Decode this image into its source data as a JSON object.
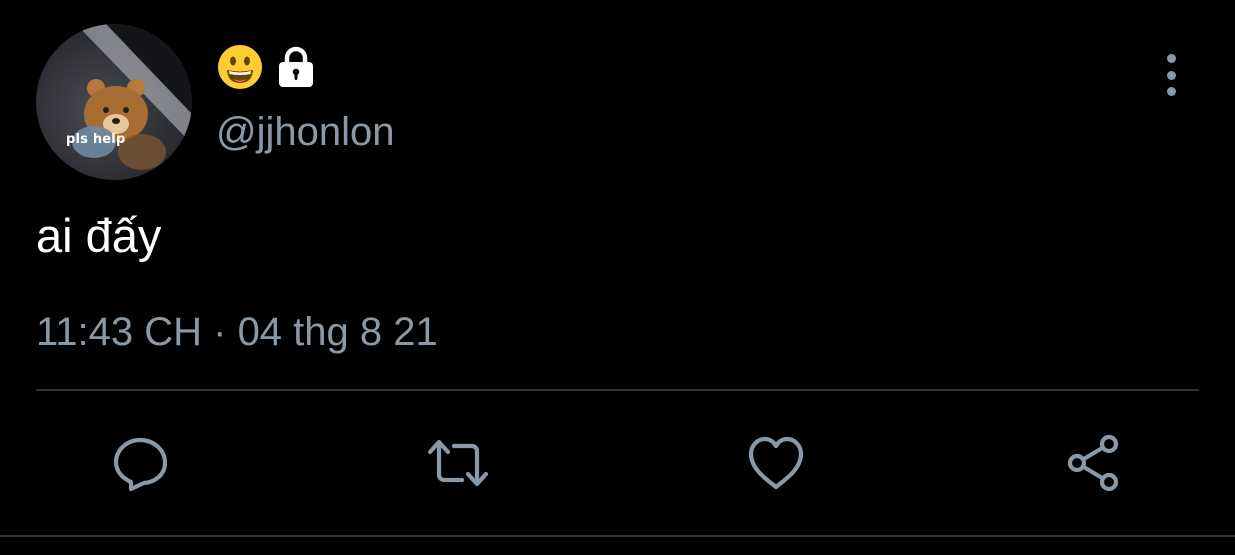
{
  "profile": {
    "avatar_caption": "pls help",
    "handle": "@jjhonlon",
    "name_icons": [
      "grinning-face-emoji",
      "lock-icon"
    ]
  },
  "tweet": {
    "text": "ai đấy",
    "timestamp": "11:43 CH · 04 thg 8 21"
  },
  "actions": [
    "reply-icon",
    "retweet-icon",
    "like-icon",
    "share-icon"
  ],
  "colors": {
    "background": "#000000",
    "primary_text": "#ffffff",
    "secondary_text": "#8b98a5",
    "divider": "#2f3336",
    "emoji_yellow": "#ffcc33"
  }
}
